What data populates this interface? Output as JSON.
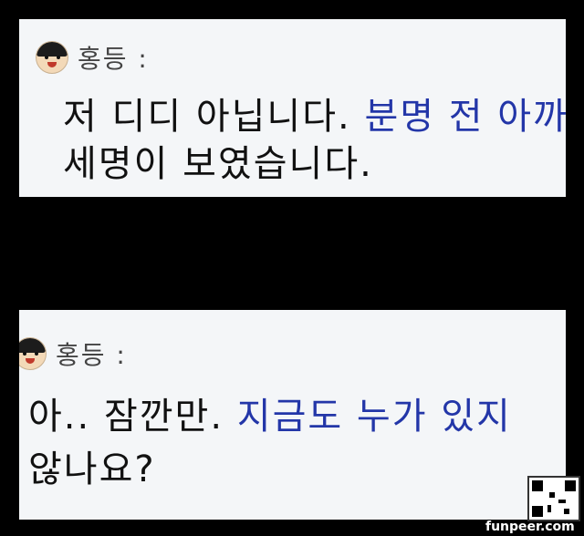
{
  "panels": [
    {
      "speaker": "홍등 :",
      "line1_plain": "저 디디 아닙니다. ",
      "line1_blue": "분명 전 아까",
      "line2": "세명이 보였습니다."
    },
    {
      "speaker": "홍등 :",
      "line1_plain": "아.. 잠깐만. ",
      "line1_blue": "지금도 누가 있지",
      "line2": "않나요?"
    }
  ],
  "watermark": "funpeer.com",
  "colors": {
    "blue_text": "#2336a8",
    "panel_bg": "#f4f6f8"
  }
}
